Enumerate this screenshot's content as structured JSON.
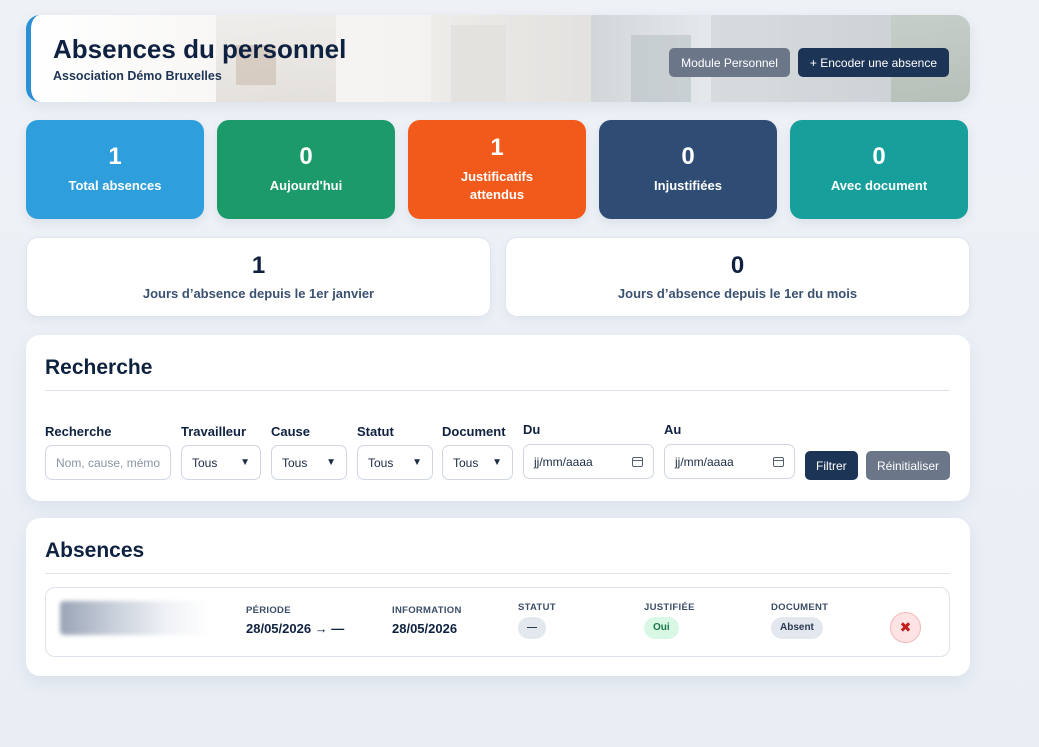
{
  "header": {
    "title": "Absences du personnel",
    "subtitle": "Association Démo Bruxelles",
    "module_button": "Module Personnel",
    "add_button": "+ Encoder une absence"
  },
  "stats": [
    {
      "value": "1",
      "label": "Total absences",
      "color": "#2e9fdc"
    },
    {
      "value": "0",
      "label": "Aujourd'hui",
      "color": "#1c9a6a"
    },
    {
      "value": "1",
      "label": "Justificatifs attendus",
      "color": "#f25a1c"
    },
    {
      "value": "0",
      "label": "Injustifiées",
      "color": "#2f4c74"
    },
    {
      "value": "0",
      "label": "Avec document",
      "color": "#179f9c"
    }
  ],
  "days": [
    {
      "value": "1",
      "label": "Jours d’absence depuis le 1er janvier"
    },
    {
      "value": "0",
      "label": "Jours d’absence depuis le 1er du mois"
    }
  ],
  "search": {
    "title": "Recherche",
    "fields": {
      "query": {
        "label": "Recherche",
        "placeholder": "Nom, cause, mémo"
      },
      "worker": {
        "label": "Travailleur",
        "value": "Tous"
      },
      "cause": {
        "label": "Cause",
        "value": "Tous"
      },
      "status": {
        "label": "Statut",
        "value": "Tous"
      },
      "document": {
        "label": "Document",
        "value": "Tous"
      },
      "from": {
        "label": "Du",
        "value": "jj/mm/aaaa"
      },
      "to": {
        "label": "Au",
        "value": "jj/mm/aaaa"
      }
    },
    "filter_button": "Filtrer",
    "reset_button": "Réinitialiser"
  },
  "absences": {
    "title": "Absences",
    "rows": [
      {
        "period_header": "PÉRIODE",
        "period": "28/05/2026 → —",
        "info_header": "INFORMATION",
        "info": "28/05/2026",
        "status_header": "STATUT",
        "status": "—",
        "justified_header": "JUSTIFIÉE",
        "justified": "Oui",
        "document_header": "DOCUMENT",
        "document": "Absent",
        "delete_icon": "close-icon"
      }
    ]
  },
  "colors": {
    "accent": "#2b8fd6",
    "navy_button": "#1c3456",
    "grey_button": "#6b7689",
    "danger": "#c41e1e"
  }
}
